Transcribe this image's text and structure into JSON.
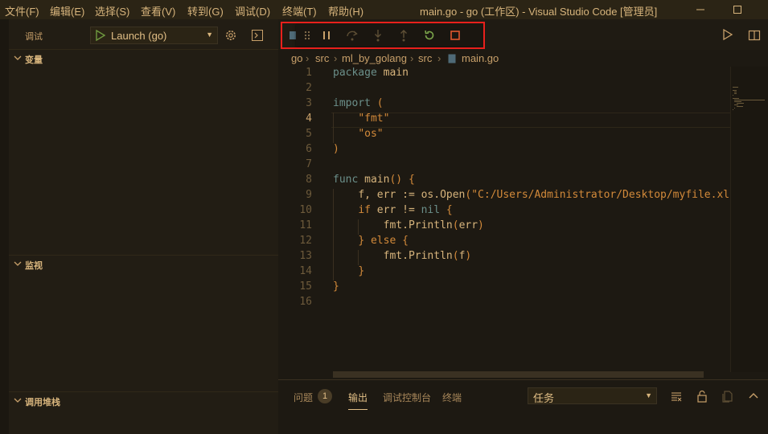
{
  "window": {
    "title": "main.go - go (工作区) - Visual Studio Code [管理员]",
    "menu": [
      "文件(F)",
      "编辑(E)",
      "选择(S)",
      "查看(V)",
      "转到(G)",
      "调试(D)",
      "终端(T)",
      "帮助(H)"
    ]
  },
  "sidebar": {
    "title": "调试",
    "launch_config": "Launch (go)",
    "sections": {
      "variables": "变量",
      "watch": "监视",
      "call_stack": "调用堆栈"
    }
  },
  "debug_toolbar": {
    "buttons": [
      "drag-handle",
      "pause",
      "step-over",
      "step-into",
      "step-out",
      "restart",
      "stop"
    ]
  },
  "breadcrumb": [
    "go",
    "src",
    "ml_by_golang",
    "src",
    "main.go"
  ],
  "editor": {
    "active_line": 4,
    "lines": [
      {
        "n": "1",
        "text": "package main"
      },
      {
        "n": "2",
        "text": ""
      },
      {
        "n": "3",
        "text": "import ("
      },
      {
        "n": "4",
        "text": "    \"fmt\""
      },
      {
        "n": "5",
        "text": "    \"os\""
      },
      {
        "n": "6",
        "text": ")"
      },
      {
        "n": "7",
        "text": ""
      },
      {
        "n": "8",
        "text": "func main() {"
      },
      {
        "n": "9",
        "text": "    f, err := os.Open(\"C:/Users/Administrator/Desktop/myfile.xls\")"
      },
      {
        "n": "10",
        "text": "    if err != nil {"
      },
      {
        "n": "11",
        "text": "        fmt.Println(err)"
      },
      {
        "n": "12",
        "text": "    } else {"
      },
      {
        "n": "13",
        "text": "        fmt.Println(f)"
      },
      {
        "n": "14",
        "text": "    }"
      },
      {
        "n": "15",
        "text": "}"
      },
      {
        "n": "16",
        "text": ""
      }
    ]
  },
  "panel": {
    "tabs": {
      "problems": "问题",
      "output": "输出",
      "debug_console": "调试控制台",
      "terminal": "终端"
    },
    "problems_count": "1",
    "active_tab": "输出",
    "task_select": "任务"
  },
  "colors": {
    "highlight_box": "#e8201c",
    "keyword": "#6b8f8a",
    "string": "#d38a3a",
    "text": "#c8a06a"
  }
}
